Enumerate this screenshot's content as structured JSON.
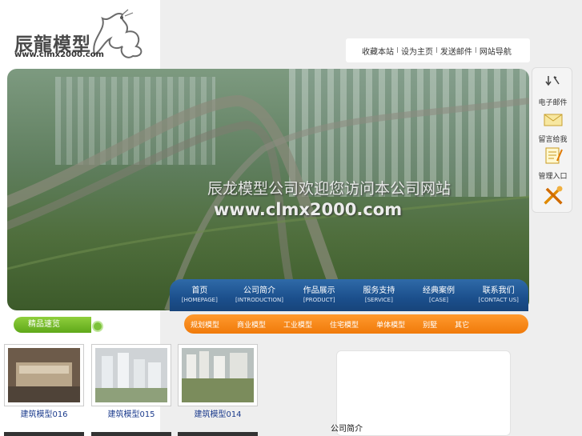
{
  "logo": {
    "title": "辰龍模型",
    "url": "www.clmx2000.com"
  },
  "toplinks": [
    {
      "label": "收藏本站"
    },
    {
      "label": "设为主页"
    },
    {
      "label": "发送邮件"
    },
    {
      "label": "网站导航"
    }
  ],
  "toplinks_sep": "I",
  "banner": {
    "slogan": "辰龙模型公司欢迎您访问本公司网站",
    "site": "www.clmx2000.com"
  },
  "side_panel": {
    "top_icon": "arrow-icon",
    "items": [
      {
        "label": "电子邮件",
        "icon": "envelope-icon"
      },
      {
        "label": "留言给我",
        "icon": "note-icon"
      },
      {
        "label": "管理入口",
        "icon": "tools-icon"
      }
    ]
  },
  "nav": [
    {
      "cn": "首页",
      "en": "[HOMEPAGE]"
    },
    {
      "cn": "公司简介",
      "en": "[INTRODUCTION]"
    },
    {
      "cn": "作品展示",
      "en": "[PRODUCT]"
    },
    {
      "cn": "服务支持",
      "en": "[SERVICE]"
    },
    {
      "cn": "经典案例",
      "en": "[CASE]"
    },
    {
      "cn": "联系我们",
      "en": "[CONTACT US]"
    }
  ],
  "subnav": [
    {
      "label": "规划模型"
    },
    {
      "label": "商业模型"
    },
    {
      "label": "工业模型"
    },
    {
      "label": "住宅模型"
    },
    {
      "label": "单体模型"
    },
    {
      "label": "别墅"
    },
    {
      "label": "其它"
    }
  ],
  "section": {
    "title": "精品速览"
  },
  "products": [
    {
      "caption": "建筑模型016"
    },
    {
      "caption": "建筑模型015"
    },
    {
      "caption": "建筑模型014"
    }
  ],
  "info": {
    "title": "公司简介"
  },
  "colors": {
    "nav_blue": "#1b4f8c",
    "subnav_orange": "#f07a0a",
    "section_green": "#5fa81a",
    "caption_blue": "#1a3a8c"
  }
}
